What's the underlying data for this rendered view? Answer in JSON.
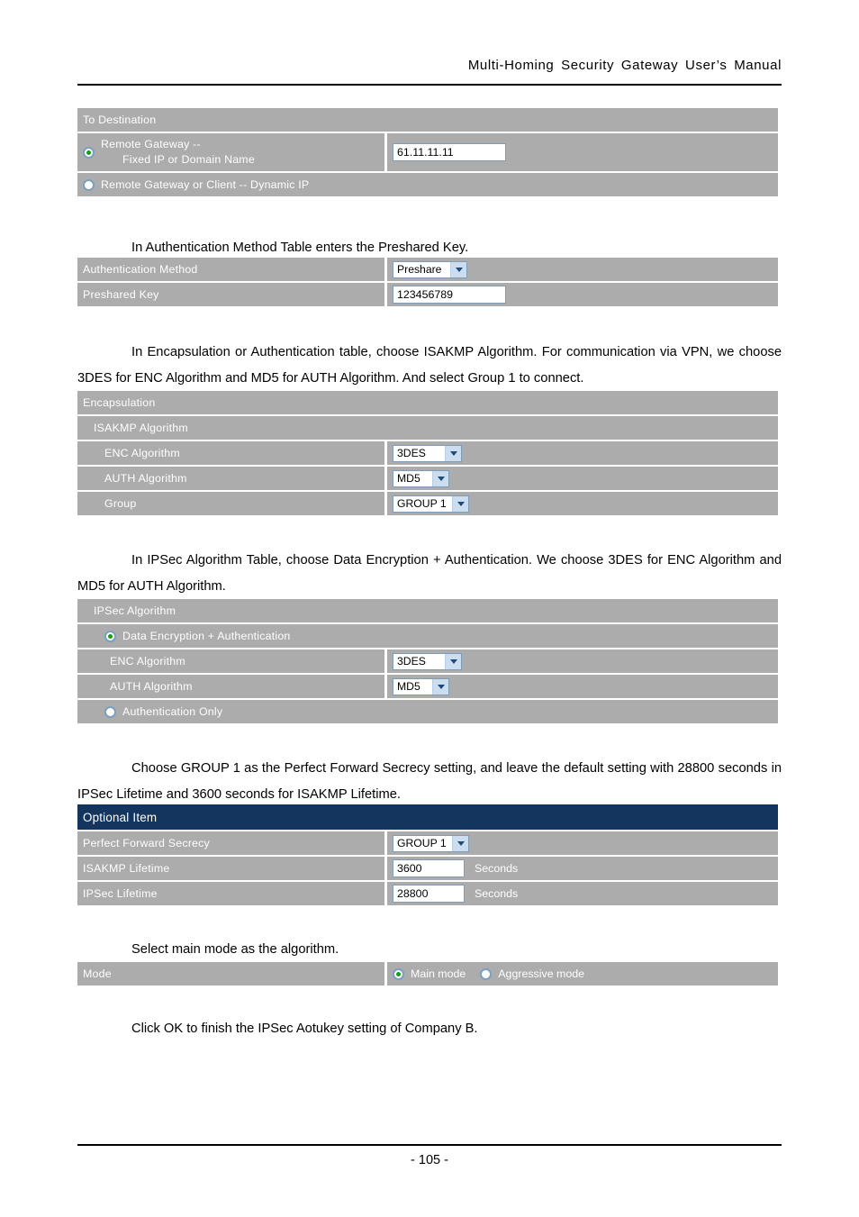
{
  "document": {
    "header_title": "Multi-Homing  Security  Gateway  User’s  Manual",
    "page_number": "- 105 -"
  },
  "paragraphs": {
    "p1": "In Authentication Method Table enters the Preshared Key.",
    "p2": "In Encapsulation or Authentication table, choose ISAKMP Algorithm. For communication via VPN, we choose 3DES for ENC Algorithm and MD5 for AUTH Algorithm. And select Group 1 to connect.",
    "p3": "In IPSec Algorithm Table, choose Data Encryption + Authentication. We choose 3DES for ENC Algorithm and MD5 for AUTH Algorithm.",
    "p4": "Choose GROUP 1 as the Perfect Forward Secrecy setting, and leave the default setting with 28800 seconds in IPSec Lifetime and 3600 seconds for ISAKMP Lifetime.",
    "p5": "Select main mode as the algorithm.",
    "p6": "Click OK to finish the IPSec Aotukey setting of Company B."
  },
  "colors": {
    "row_gray": "#acacac",
    "header_navy": "#13355e",
    "label_text": "#ffffff",
    "radio_dot_green": "#1a9a1a",
    "input_border": "#7f9db9",
    "select_button": "#cdddf0",
    "chevron": "#1c4a7a"
  },
  "to_destination": {
    "title": "To Destination",
    "remote_gateway_line1": "Remote Gateway --",
    "remote_gateway_line2": "Fixed IP or Domain Name",
    "remote_gateway_selected": true,
    "ip_value": "61.11.11.11",
    "dynamic_label": "Remote Gateway or Client -- Dynamic IP",
    "dynamic_selected": false
  },
  "auth_method": {
    "method_label": "Authentication Method",
    "method_value": "Preshare",
    "preshared_key_label": "Preshared Key",
    "preshared_key_value": "123456789"
  },
  "encapsulation": {
    "title": "Encapsulation",
    "isakmp_title": "ISAKMP Algorithm",
    "enc_label": "ENC Algorithm",
    "enc_value": "3DES",
    "auth_label": "AUTH Algorithm",
    "auth_value": "MD5",
    "group_label": "Group",
    "group_value": "GROUP 1"
  },
  "ipsec_algorithm": {
    "title": "IPSec Algorithm",
    "data_enc_auth_label": "Data Encryption + Authentication",
    "data_enc_auth_selected": true,
    "enc_label": "ENC Algorithm",
    "enc_value": "3DES",
    "auth_label": "AUTH Algorithm",
    "auth_value": "MD5",
    "auth_only_label": "Authentication Only",
    "auth_only_selected": false
  },
  "optional_item": {
    "title": "Optional Item",
    "pfs_label": "Perfect Forward Secrecy",
    "pfs_value": "GROUP 1",
    "isakmp_lifetime_label": "ISAKMP Lifetime",
    "isakmp_lifetime_value": "3600",
    "isakmp_lifetime_unit": "Seconds",
    "ipsec_lifetime_label": "IPSec Lifetime",
    "ipsec_lifetime_value": "28800",
    "ipsec_lifetime_unit": "Seconds"
  },
  "mode": {
    "label": "Mode",
    "main_mode_label": "Main mode",
    "main_mode_selected": true,
    "aggressive_mode_label": "Aggressive mode",
    "aggressive_mode_selected": false
  }
}
